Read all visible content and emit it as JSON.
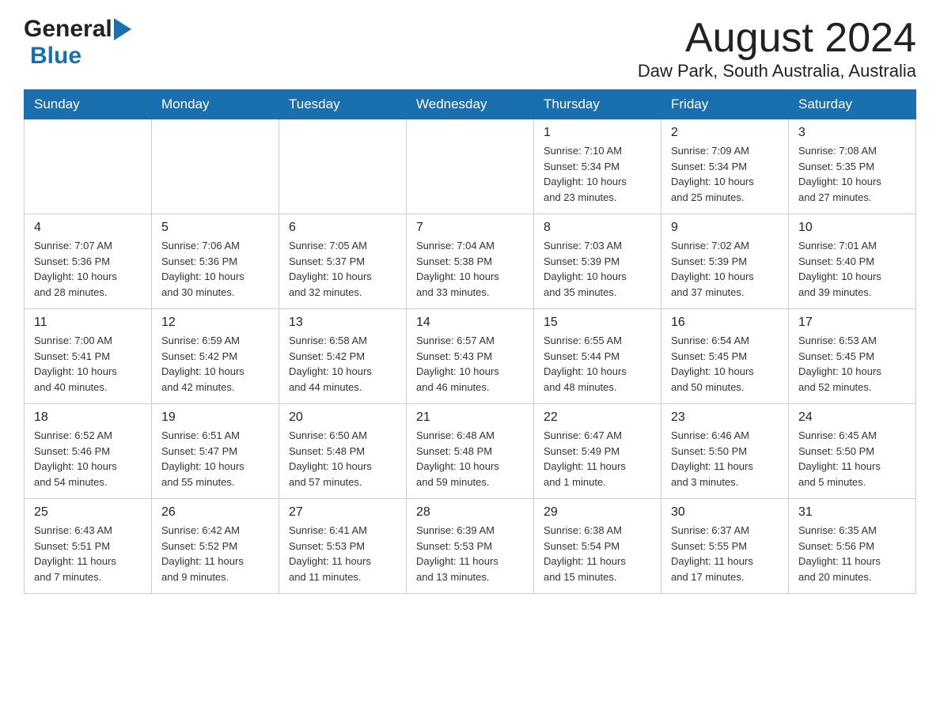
{
  "header": {
    "logo_general": "General",
    "logo_blue": "Blue",
    "month_title": "August 2024",
    "location": "Daw Park, South Australia, Australia"
  },
  "weekdays": [
    "Sunday",
    "Monday",
    "Tuesday",
    "Wednesday",
    "Thursday",
    "Friday",
    "Saturday"
  ],
  "weeks": [
    [
      {
        "day": "",
        "info": ""
      },
      {
        "day": "",
        "info": ""
      },
      {
        "day": "",
        "info": ""
      },
      {
        "day": "",
        "info": ""
      },
      {
        "day": "1",
        "info": "Sunrise: 7:10 AM\nSunset: 5:34 PM\nDaylight: 10 hours\nand 23 minutes."
      },
      {
        "day": "2",
        "info": "Sunrise: 7:09 AM\nSunset: 5:34 PM\nDaylight: 10 hours\nand 25 minutes."
      },
      {
        "day": "3",
        "info": "Sunrise: 7:08 AM\nSunset: 5:35 PM\nDaylight: 10 hours\nand 27 minutes."
      }
    ],
    [
      {
        "day": "4",
        "info": "Sunrise: 7:07 AM\nSunset: 5:36 PM\nDaylight: 10 hours\nand 28 minutes."
      },
      {
        "day": "5",
        "info": "Sunrise: 7:06 AM\nSunset: 5:36 PM\nDaylight: 10 hours\nand 30 minutes."
      },
      {
        "day": "6",
        "info": "Sunrise: 7:05 AM\nSunset: 5:37 PM\nDaylight: 10 hours\nand 32 minutes."
      },
      {
        "day": "7",
        "info": "Sunrise: 7:04 AM\nSunset: 5:38 PM\nDaylight: 10 hours\nand 33 minutes."
      },
      {
        "day": "8",
        "info": "Sunrise: 7:03 AM\nSunset: 5:39 PM\nDaylight: 10 hours\nand 35 minutes."
      },
      {
        "day": "9",
        "info": "Sunrise: 7:02 AM\nSunset: 5:39 PM\nDaylight: 10 hours\nand 37 minutes."
      },
      {
        "day": "10",
        "info": "Sunrise: 7:01 AM\nSunset: 5:40 PM\nDaylight: 10 hours\nand 39 minutes."
      }
    ],
    [
      {
        "day": "11",
        "info": "Sunrise: 7:00 AM\nSunset: 5:41 PM\nDaylight: 10 hours\nand 40 minutes."
      },
      {
        "day": "12",
        "info": "Sunrise: 6:59 AM\nSunset: 5:42 PM\nDaylight: 10 hours\nand 42 minutes."
      },
      {
        "day": "13",
        "info": "Sunrise: 6:58 AM\nSunset: 5:42 PM\nDaylight: 10 hours\nand 44 minutes."
      },
      {
        "day": "14",
        "info": "Sunrise: 6:57 AM\nSunset: 5:43 PM\nDaylight: 10 hours\nand 46 minutes."
      },
      {
        "day": "15",
        "info": "Sunrise: 6:55 AM\nSunset: 5:44 PM\nDaylight: 10 hours\nand 48 minutes."
      },
      {
        "day": "16",
        "info": "Sunrise: 6:54 AM\nSunset: 5:45 PM\nDaylight: 10 hours\nand 50 minutes."
      },
      {
        "day": "17",
        "info": "Sunrise: 6:53 AM\nSunset: 5:45 PM\nDaylight: 10 hours\nand 52 minutes."
      }
    ],
    [
      {
        "day": "18",
        "info": "Sunrise: 6:52 AM\nSunset: 5:46 PM\nDaylight: 10 hours\nand 54 minutes."
      },
      {
        "day": "19",
        "info": "Sunrise: 6:51 AM\nSunset: 5:47 PM\nDaylight: 10 hours\nand 55 minutes."
      },
      {
        "day": "20",
        "info": "Sunrise: 6:50 AM\nSunset: 5:48 PM\nDaylight: 10 hours\nand 57 minutes."
      },
      {
        "day": "21",
        "info": "Sunrise: 6:48 AM\nSunset: 5:48 PM\nDaylight: 10 hours\nand 59 minutes."
      },
      {
        "day": "22",
        "info": "Sunrise: 6:47 AM\nSunset: 5:49 PM\nDaylight: 11 hours\nand 1 minute."
      },
      {
        "day": "23",
        "info": "Sunrise: 6:46 AM\nSunset: 5:50 PM\nDaylight: 11 hours\nand 3 minutes."
      },
      {
        "day": "24",
        "info": "Sunrise: 6:45 AM\nSunset: 5:50 PM\nDaylight: 11 hours\nand 5 minutes."
      }
    ],
    [
      {
        "day": "25",
        "info": "Sunrise: 6:43 AM\nSunset: 5:51 PM\nDaylight: 11 hours\nand 7 minutes."
      },
      {
        "day": "26",
        "info": "Sunrise: 6:42 AM\nSunset: 5:52 PM\nDaylight: 11 hours\nand 9 minutes."
      },
      {
        "day": "27",
        "info": "Sunrise: 6:41 AM\nSunset: 5:53 PM\nDaylight: 11 hours\nand 11 minutes."
      },
      {
        "day": "28",
        "info": "Sunrise: 6:39 AM\nSunset: 5:53 PM\nDaylight: 11 hours\nand 13 minutes."
      },
      {
        "day": "29",
        "info": "Sunrise: 6:38 AM\nSunset: 5:54 PM\nDaylight: 11 hours\nand 15 minutes."
      },
      {
        "day": "30",
        "info": "Sunrise: 6:37 AM\nSunset: 5:55 PM\nDaylight: 11 hours\nand 17 minutes."
      },
      {
        "day": "31",
        "info": "Sunrise: 6:35 AM\nSunset: 5:56 PM\nDaylight: 11 hours\nand 20 minutes."
      }
    ]
  ]
}
